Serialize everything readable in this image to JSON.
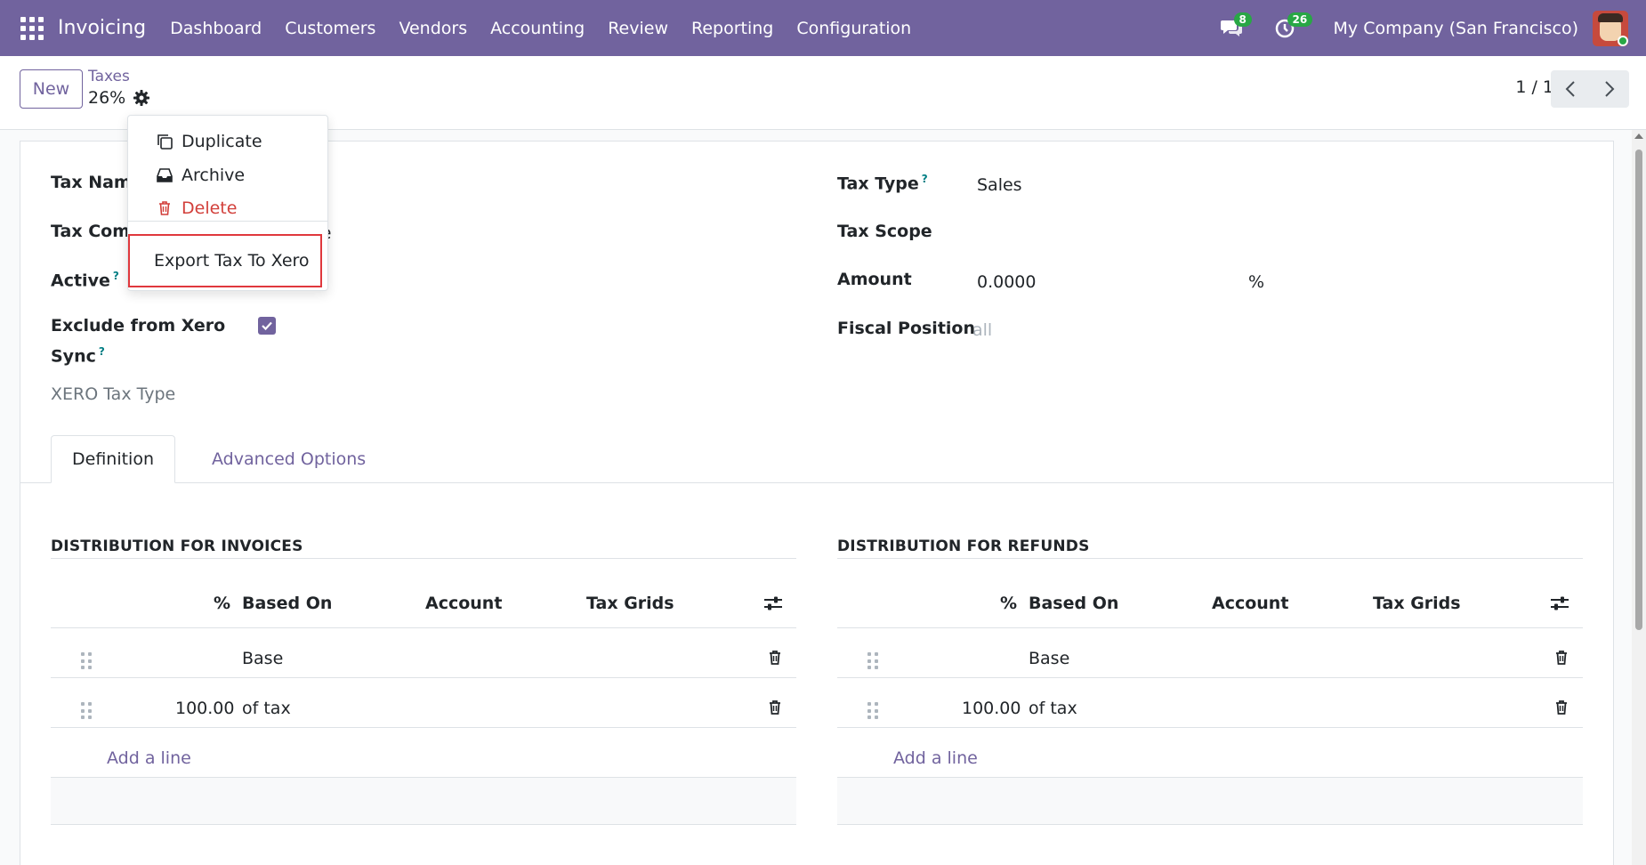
{
  "navbar": {
    "app_name": "Invoicing",
    "menu": [
      "Dashboard",
      "Customers",
      "Vendors",
      "Accounting",
      "Review",
      "Reporting",
      "Configuration"
    ],
    "messages_count": "8",
    "activities_count": "26",
    "company": "My Company (San Francisco)"
  },
  "control": {
    "new_label": "New",
    "breadcrumb_parent": "Taxes",
    "breadcrumb_current": "26%",
    "pager": "1 / 1"
  },
  "dropdown": {
    "duplicate": "Duplicate",
    "archive": "Archive",
    "delete": "Delete",
    "export": "Export Tax To Xero"
  },
  "form": {
    "tax_name_label": "Tax Name",
    "tax_comp_label": "Tax Comp",
    "tax_comp_value_tail": "age",
    "active_label": "Active",
    "exclude_label_line1": "Exclude from Xero",
    "exclude_label_line2": "Sync",
    "xero_tax_type_label": "XERO Tax Type",
    "help_mark": "?",
    "tax_type_label": "Tax Type",
    "tax_type_value": "Sales",
    "tax_scope_label": "Tax Scope",
    "amount_label": "Amount",
    "amount_value": "0.0000",
    "amount_unit": "%",
    "fiscal_position_label": "Fiscal Position",
    "fiscal_position_placeholder": "all",
    "exclude_checked": true
  },
  "tabs": [
    "Definition",
    "Advanced Options"
  ],
  "invoices": {
    "title": "DISTRIBUTION FOR INVOICES",
    "headers": {
      "pct": "%",
      "based_on": "Based On",
      "account": "Account",
      "tax_grids": "Tax Grids"
    },
    "rows": [
      {
        "pct": "",
        "based_on": "Base"
      },
      {
        "pct": "100.00",
        "based_on": "of tax"
      }
    ],
    "add_line": "Add a line"
  },
  "refunds": {
    "title": "DISTRIBUTION FOR REFUNDS",
    "headers": {
      "pct": "%",
      "based_on": "Based On",
      "account": "Account",
      "tax_grids": "Tax Grids"
    },
    "rows": [
      {
        "pct": "",
        "based_on": "Base"
      },
      {
        "pct": "100.00",
        "based_on": "of tax"
      }
    ],
    "add_line": "Add a line"
  },
  "colors": {
    "brand": "#71639e",
    "badge": "#28a745",
    "danger": "#d23f3a",
    "highlight": "#e0383d",
    "help": "#017e84"
  }
}
